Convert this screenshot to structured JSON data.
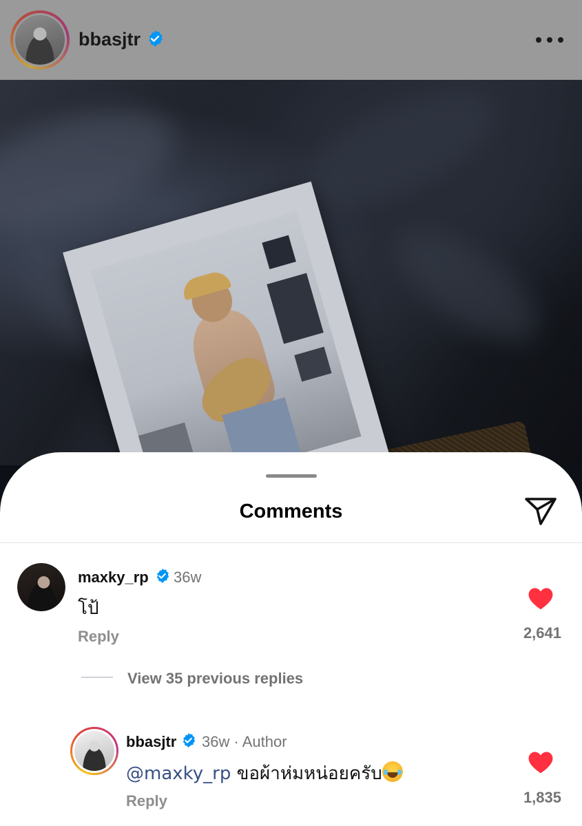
{
  "header": {
    "username": "bbasjtr",
    "verified": true,
    "more_icon": "more-horizontal-icon"
  },
  "post": {
    "image_icon": "post-photo"
  },
  "comments_sheet": {
    "title": "Comments",
    "share_icon": "paper-plane-icon"
  },
  "comments": [
    {
      "username": "maxky_rp",
      "verified": true,
      "time": "36w",
      "text": "โป้",
      "reply_label": "Reply",
      "likes": "2,641",
      "liked": true
    }
  ],
  "view_replies": "View 35 previous replies",
  "reply": {
    "username": "bbasjtr",
    "verified": true,
    "time": "36w · Author",
    "mention": "@maxky_rp",
    "text": " ขอผ้าห่มหน่อยครับ",
    "emoji": "face-with-tears-of-joy",
    "reply_label": "Reply",
    "likes": "1,835",
    "liked": true
  },
  "colors": {
    "verified_blue": "#0095f6",
    "heart_red": "#ff3040",
    "mention_blue": "#385185",
    "muted_text": "#737373"
  }
}
